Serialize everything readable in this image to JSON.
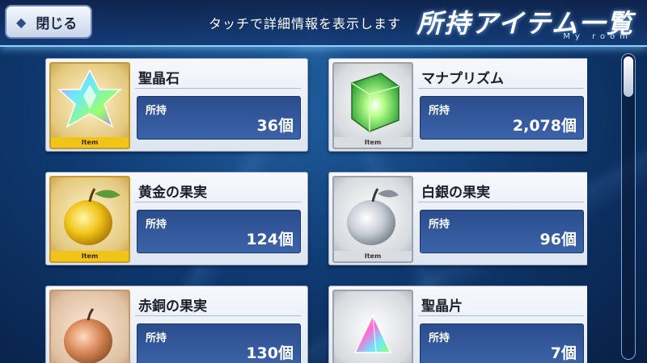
{
  "header": {
    "close_label": "閉じる",
    "hint": "タッチで詳細情報を表示します",
    "title": "所持アイテム一覧",
    "subtitle": "My room"
  },
  "colors": {
    "accent": "#8fd0ff",
    "qty_box": "#2b4d8e",
    "gold_tag": "#f0c419"
  },
  "items": [
    {
      "name": "聖晶石",
      "qty_label": "所持",
      "qty": "36個",
      "tag": "Item",
      "frame": "gold",
      "icon": "star-crystal-icon"
    },
    {
      "name": "マナプリズム",
      "qty_label": "所持",
      "qty": "2,078個",
      "tag": "Item",
      "frame": "silver",
      "icon": "mana-prism-icon"
    },
    {
      "name": "黄金の果実",
      "qty_label": "所持",
      "qty": "124個",
      "tag": "Item",
      "frame": "gold",
      "icon": "golden-apple-icon"
    },
    {
      "name": "白銀の果実",
      "qty_label": "所持",
      "qty": "96個",
      "tag": "Item",
      "frame": "silver",
      "icon": "silver-apple-icon"
    },
    {
      "name": "赤銅の果実",
      "qty_label": "所持",
      "qty": "130個",
      "tag": "",
      "frame": "bronze",
      "icon": "bronze-apple-icon"
    },
    {
      "name": "聖晶片",
      "qty_label": "所持",
      "qty": "7個",
      "tag": "",
      "frame": "silver",
      "icon": "quartz-fragment-icon"
    }
  ]
}
